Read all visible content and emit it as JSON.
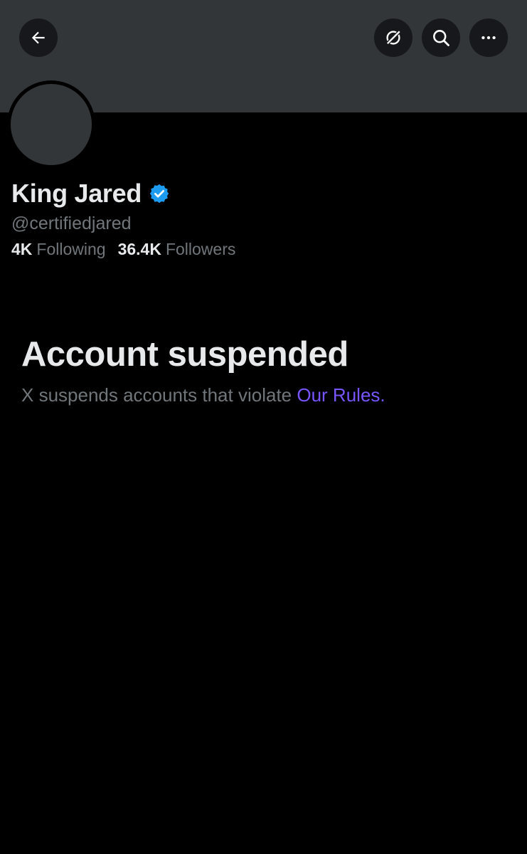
{
  "header": {
    "back_icon": "arrow-left-icon",
    "grok_icon": "grok-icon",
    "search_icon": "search-icon",
    "more_icon": "more-horizontal-icon",
    "banner_color": "#333639"
  },
  "profile": {
    "display_name": "King Jared",
    "verified_icon": "verified-badge-icon",
    "verified_color": "#1d9bf0",
    "handle": "@certifiedjared",
    "following_count": "4K",
    "following_label": "Following",
    "followers_count": "36.4K",
    "followers_label": "Followers"
  },
  "suspension": {
    "title": "Account suspended",
    "description": "X suspends accounts that violate ",
    "link_text": "Our Rules",
    "trailing": ".",
    "link_color": "#7856ff"
  }
}
